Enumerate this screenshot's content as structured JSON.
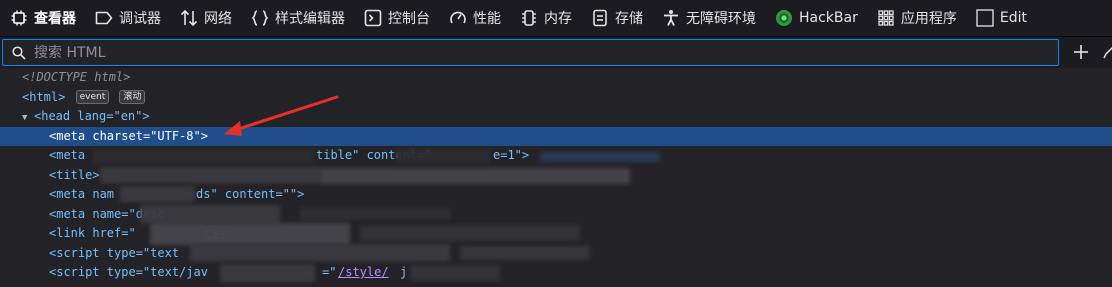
{
  "toolbar": {
    "tabs": [
      {
        "label": "查看器",
        "icon": "inspector-icon"
      },
      {
        "label": "调试器",
        "icon": "debugger-icon"
      },
      {
        "label": "网络",
        "icon": "network-icon"
      },
      {
        "label": "样式编辑器",
        "icon": "style-editor-icon"
      },
      {
        "label": "控制台",
        "icon": "console-icon"
      },
      {
        "label": "性能",
        "icon": "performance-icon"
      },
      {
        "label": "内存",
        "icon": "memory-icon"
      },
      {
        "label": "存储",
        "icon": "storage-icon"
      },
      {
        "label": "无障碍环境",
        "icon": "accessibility-icon"
      },
      {
        "label": "HackBar",
        "icon": "hackbar-icon"
      },
      {
        "label": "应用程序",
        "icon": "application-icon"
      },
      {
        "label": "Edit",
        "icon": "edit-icon"
      }
    ]
  },
  "search": {
    "placeholder": "搜索 HTML",
    "value": ""
  },
  "tree": {
    "doctype": "<!DOCTYPE html>",
    "html_open": "<html>",
    "badge_event": "event",
    "badge_scroll": "滚动",
    "head_open": "<head lang=\"en\">",
    "meta_charset": {
      "tag_open": "<meta ",
      "attr": "charset",
      "eq": "=\"",
      "value": "UTF-8",
      "close": "\">"
    },
    "meta2_prefix": "<meta",
    "meta2_tail": "tible\"  content=\"",
    "meta2_tail2": "e=1\">",
    "title_prefix": "<title>",
    "meta3_prefix": "<meta nam",
    "meta3_mid": "ds\" content=\"\">",
    "meta4_prefix": "<meta name=\"desc",
    "link_prefix": "<link href=\"",
    "link_mid": "css",
    "script1_prefix": "<script type=\"text",
    "script2_prefix": "<script type=\"text/jav",
    "script2_mid": "=\"",
    "script2_link": "/style/",
    "script2_tail": "j"
  },
  "colors": {
    "accent": "#0a84ff",
    "selection": "#204e8a",
    "arrow": "#e8302a",
    "tag": "#75bfff",
    "attr": "#ff7de9",
    "value": "#b98eff"
  }
}
